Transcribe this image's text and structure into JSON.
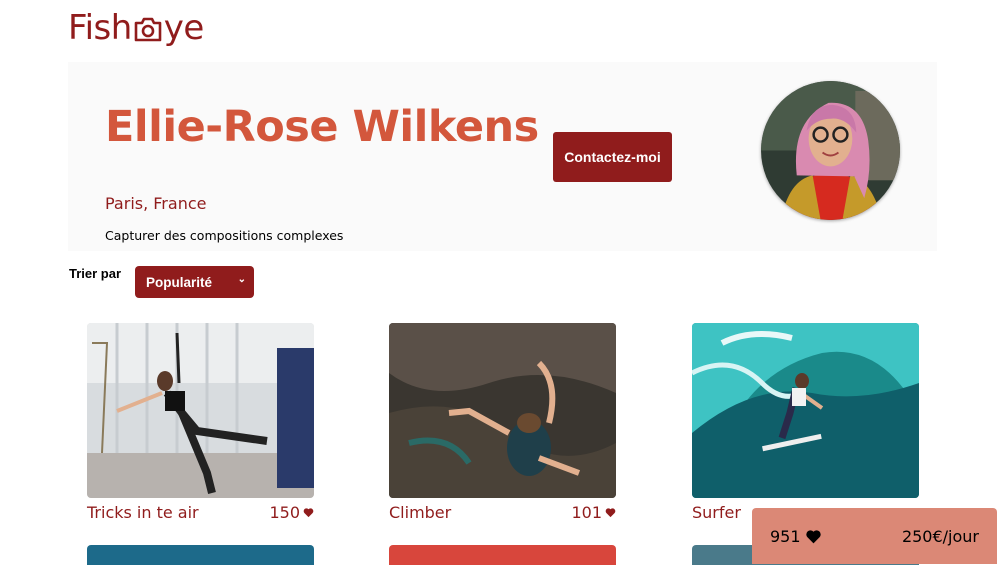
{
  "logo": {
    "pre": "Fish",
    "post": "ye",
    "icon": "camera-icon"
  },
  "photographer": {
    "name": "Ellie-Rose Wilkens",
    "location": "Paris, France",
    "tagline": "Capturer des compositions complexes",
    "contact_label": "Contactez-moi"
  },
  "sort": {
    "label": "Trier par",
    "selected": "Popularité"
  },
  "media": [
    {
      "title": "Tricks in te air",
      "likes": "150"
    },
    {
      "title": "Climber",
      "likes": "101"
    },
    {
      "title": "Surfer",
      "likes": ""
    }
  ],
  "summary": {
    "total_likes": "951",
    "price": "250€/jour"
  },
  "colors": {
    "primary": "#901C1C",
    "secondary": "#D3573C",
    "sticky": "#DB8876",
    "banner": "#FAFAFA"
  }
}
